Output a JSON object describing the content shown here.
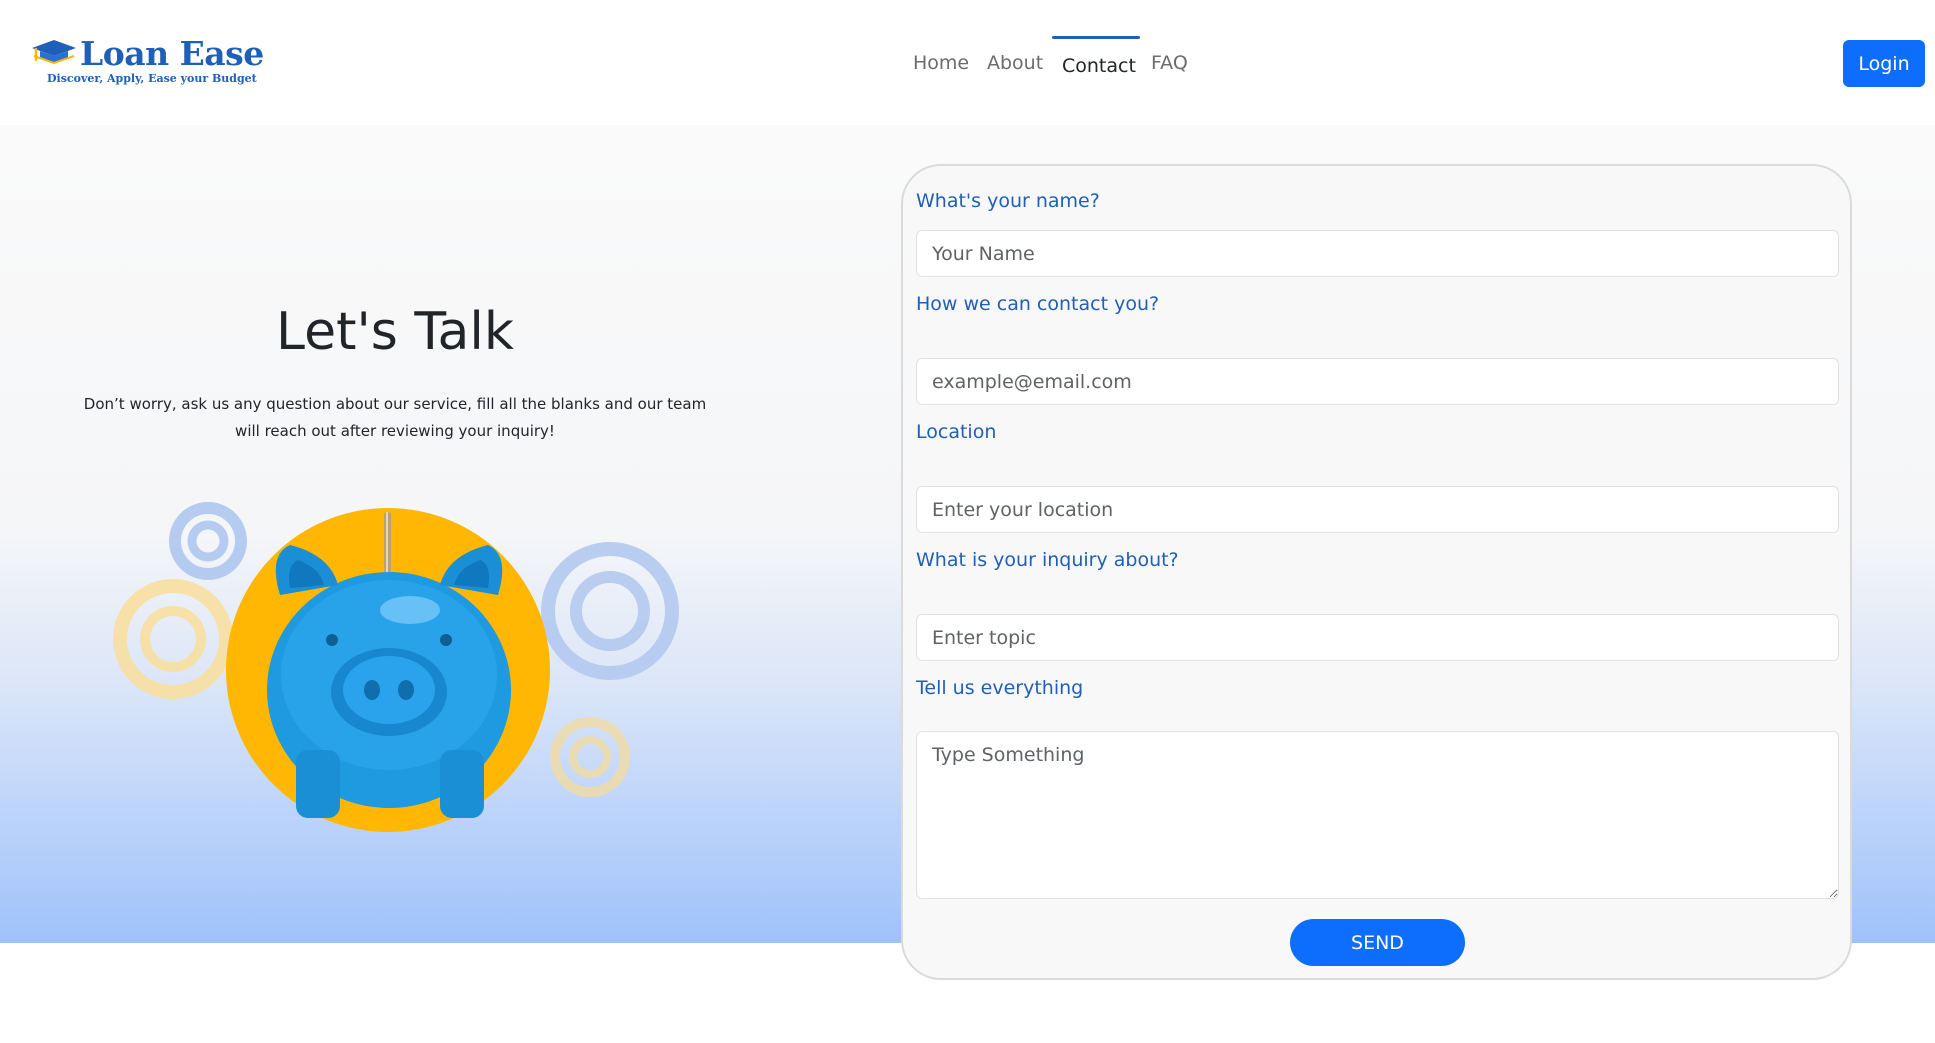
{
  "brand": {
    "name": "Loan Ease",
    "tagline": "Discover, Apply, Ease your Budget",
    "color": "#1f5fb8"
  },
  "nav": {
    "items": [
      {
        "label": "Home",
        "active": false
      },
      {
        "label": "About",
        "active": false
      },
      {
        "label": "Contact",
        "active": true
      },
      {
        "label": "FAQ",
        "active": false
      }
    ],
    "login_label": "Login"
  },
  "hero": {
    "title": "Let's Talk",
    "subtitle": "Don’t worry, ask us any question about our service, fill all the blanks and our team will reach out after reviewing your inquiry!"
  },
  "form": {
    "name": {
      "label": "What's your name?",
      "placeholder": "Your Name"
    },
    "contact": {
      "label": "How we can contact you?",
      "placeholder": "example@email.com"
    },
    "location": {
      "label": "Location",
      "placeholder": "Enter your location"
    },
    "topic": {
      "label": "What is your inquiry about?",
      "placeholder": "Enter topic"
    },
    "message": {
      "label": "Tell us everything",
      "placeholder": "Type Something"
    },
    "send_label": "SEND"
  },
  "colors": {
    "primary": "#0d6efd",
    "label": "#1f5fb8",
    "accent_yellow": "#ffb703",
    "pig_blue": "#1f9fe4"
  }
}
